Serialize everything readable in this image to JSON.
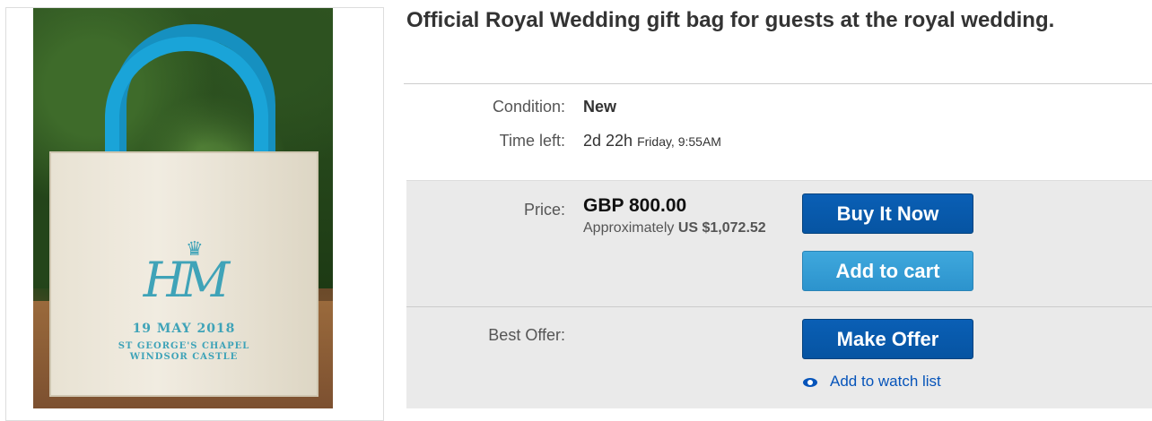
{
  "listing": {
    "title": "Official Royal Wedding gift bag for guests at the royal wedding.",
    "image": {
      "monogram": "HM",
      "date_text": "19 MAY 2018",
      "place_line1": "ST GEORGE'S CHAPEL",
      "place_line2": "WINDSOR CASTLE"
    }
  },
  "details": {
    "condition_label": "Condition:",
    "condition_value": "New",
    "time_left_label": "Time left:",
    "time_left_value": "2d 22h",
    "time_left_end": "Friday, 9:55AM"
  },
  "pricing": {
    "price_label": "Price:",
    "price_value": "GBP 800.00",
    "approx_prefix": "Approximately",
    "approx_value": "US $1,072.52",
    "buy_now_label": "Buy It Now",
    "add_to_cart_label": "Add to cart"
  },
  "offer": {
    "best_offer_label": "Best Offer:",
    "make_offer_label": "Make Offer",
    "watch_list_label": "Add to watch list"
  },
  "colors": {
    "button_dark": "#0654a2",
    "button_light": "#2c93cd",
    "link": "#0654ba",
    "panel_bg": "#eaeaea"
  }
}
